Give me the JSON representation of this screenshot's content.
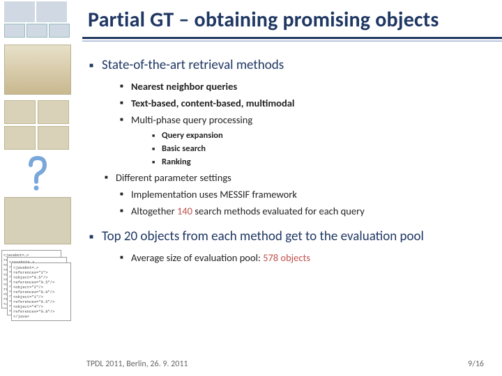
{
  "title": "Partial GT – obtaining promising objects",
  "bullets": {
    "l1_a": "State-of-the-art retrieval methods",
    "l2_a1": "Nearest neighbor queries",
    "l2_a2": "Text-based, content-based, multimodal",
    "l2_a3": "Multi-phase query processing",
    "l3_a3a": "Query expansion",
    "l3_a3b": "Basic search",
    "l3_a3c": "Ranking",
    "l2_b": "Different parameter settings",
    "l2_b1": "Implementation uses MESSIF framework",
    "l2_b2_pre": "Altogether ",
    "l2_b2_num": "140",
    "l2_b2_post": " search methods evaluated for each query",
    "l1_c": "Top 20 objects from each method get to the evaluation pool",
    "l2_c1_pre": "Average size of evaluation pool: ",
    "l2_c1_num": "578 objects"
  },
  "footer": {
    "venue": "TPDL 2011, Berlin, 26. 9. 2011",
    "page": "9/16"
  },
  "xml_snippet": "<javabot=…>\n references=\"1\">\n  <object=\"0.5\"/>\n references=\"0.5\"/>\n  <object=\"2\"/>\n references=\"0.0\"/>\n  <object=\"1\"/>\n references=\"0.5\"/>\n  <object=\"4\"/>\n references=\"0.8\"/>\n </java>"
}
